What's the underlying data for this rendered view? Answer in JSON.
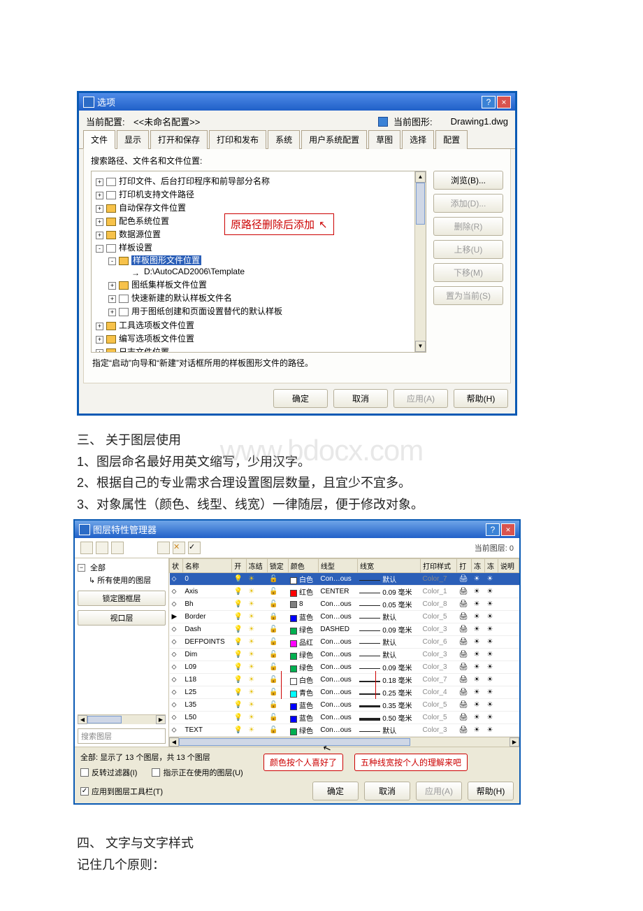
{
  "watermark": "www.bdocx.com",
  "dialog1": {
    "title": "选项",
    "profile_label": "当前配置:",
    "profile_value": "<<未命名配置>>",
    "drawing_label": "当前图形:",
    "drawing_value": "Drawing1.dwg",
    "tabs": [
      "文件",
      "显示",
      "打开和保存",
      "打印和发布",
      "系统",
      "用户系统配置",
      "草图",
      "选择",
      "配置"
    ],
    "active_tab": 0,
    "panel_label": "搜索路径、文件名和文件位置:",
    "tree": [
      {
        "exp": "+",
        "icon": "file",
        "label": "打印文件、后台打印程序和前导部分名称"
      },
      {
        "exp": "+",
        "icon": "file",
        "label": "打印机支持文件路径"
      },
      {
        "exp": "+",
        "icon": "folder",
        "label": "自动保存文件位置"
      },
      {
        "exp": "+",
        "icon": "folder",
        "label": "配色系统位置"
      },
      {
        "exp": "+",
        "icon": "folder",
        "label": "数据源位置"
      },
      {
        "exp": "-",
        "icon": "file",
        "label": "样板设置",
        "children": [
          {
            "exp": "-",
            "icon": "folder",
            "label": "样板图形文件位置",
            "selected": true,
            "children": [
              {
                "exp": "",
                "icon": "arrow",
                "label": "D:\\AutoCAD2006\\Template"
              }
            ]
          },
          {
            "exp": "+",
            "icon": "folder",
            "label": "图纸集样板文件位置"
          },
          {
            "exp": "+",
            "icon": "file",
            "label": "快速新建的默认样板文件名"
          },
          {
            "exp": "+",
            "icon": "file",
            "label": "用于图纸创建和页面设置替代的默认样板"
          }
        ]
      },
      {
        "exp": "+",
        "icon": "folder",
        "label": "工具选项板文件位置"
      },
      {
        "exp": "+",
        "icon": "folder",
        "label": "编写选项板文件位置"
      },
      {
        "exp": "+",
        "icon": "folder",
        "label": "日志文件位置"
      }
    ],
    "callout": "原路径删除后添加",
    "side_buttons": [
      {
        "label": "浏览(B)...",
        "enabled": true
      },
      {
        "label": "添加(D)...",
        "enabled": false
      },
      {
        "label": "删除(R)",
        "enabled": false
      },
      {
        "label": "上移(U)",
        "enabled": false
      },
      {
        "label": "下移(M)",
        "enabled": false
      },
      {
        "label": "置为当前(S)",
        "enabled": false
      }
    ],
    "hint": "指定“启动”向导和“新建”对话框所用的样板图形文件的路径。",
    "footer": [
      "确定",
      "取消",
      "应用(A)",
      "帮助(H)"
    ]
  },
  "section3": {
    "heading": "三、 关于图层使用",
    "lines": [
      "1、图层命名最好用英文缩写，少用汉字。",
      "2、根据自己的专业需求合理设置图层数量，且宜少不宜多。",
      "3、对象属性（颜色、线型、线宽）一律随层，便于修改对象。"
    ]
  },
  "dialog2": {
    "title": "图层特性管理器",
    "current_layer_label": "当前图层: 0",
    "filter_root": "全部",
    "filter_child": "所有使用的图层",
    "btn_lock": "锁定图框层",
    "btn_viewport": "视口层",
    "search_placeholder": "搜索图层",
    "columns": [
      "状",
      "名称",
      "开",
      "冻结",
      "锁定",
      "颜色",
      "线型",
      "线宽",
      "打印样式",
      "打",
      "冻",
      "冻",
      "说明"
    ],
    "rows": [
      {
        "name": "0",
        "on": true,
        "frz": false,
        "lock": false,
        "color": "#ffffff",
        "cname": "白色",
        "ltype": "Con…ous",
        "lw": "默认",
        "lwpx": 1,
        "plot": "Color_7",
        "sel": true
      },
      {
        "name": "Axis",
        "on": true,
        "frz": false,
        "lock": false,
        "color": "#ff0000",
        "cname": "红色",
        "ltype": "CENTER",
        "lw": "0.09 毫米",
        "lwpx": 1,
        "plot": "Color_1"
      },
      {
        "name": "Bh",
        "on": true,
        "frz": false,
        "lock": false,
        "color": "#808080",
        "cname": "8",
        "ltype": "Con…ous",
        "lw": "0.05 毫米",
        "lwpx": 1,
        "plot": "Color_8"
      },
      {
        "name": "Border",
        "on": true,
        "frz": false,
        "lock": true,
        "color": "#0000ff",
        "cname": "蓝色",
        "ltype": "Con…ous",
        "lw": "默认",
        "lwpx": 1,
        "plot": "Color_5",
        "cur": true
      },
      {
        "name": "Dash",
        "on": true,
        "frz": false,
        "lock": false,
        "color": "#00b050",
        "cname": "绿色",
        "ltype": "DASHED",
        "lw": "0.09 毫米",
        "lwpx": 1,
        "plot": "Color_3"
      },
      {
        "name": "DEFPOINTS",
        "on": true,
        "frz": false,
        "lock": false,
        "color": "#ff00ff",
        "cname": "品红",
        "ltype": "Con…ous",
        "lw": "默认",
        "lwpx": 1,
        "plot": "Color_6"
      },
      {
        "name": "Dim",
        "on": true,
        "frz": false,
        "lock": false,
        "color": "#00b050",
        "cname": "绿色",
        "ltype": "Con…ous",
        "lw": "默认",
        "lwpx": 1,
        "plot": "Color_3"
      },
      {
        "name": "L09",
        "on": true,
        "frz": false,
        "lock": false,
        "color": "#00b050",
        "cname": "绿色",
        "ltype": "Con…ous",
        "lw": "0.09 毫米",
        "lwpx": 1,
        "plot": "Color_3"
      },
      {
        "name": "L18",
        "on": true,
        "frz": false,
        "lock": false,
        "color": "#ffffff",
        "cname": "白色",
        "ltype": "Con…ous",
        "lw": "0.18 毫米",
        "lwpx": 2,
        "plot": "Color_7"
      },
      {
        "name": "L25",
        "on": true,
        "frz": false,
        "lock": false,
        "color": "#00ffff",
        "cname": "青色",
        "ltype": "Con…ous",
        "lw": "0.25 毫米",
        "lwpx": 2,
        "plot": "Color_4"
      },
      {
        "name": "L35",
        "on": true,
        "frz": false,
        "lock": false,
        "color": "#0000ff",
        "cname": "蓝色",
        "ltype": "Con…ous",
        "lw": "0.35 毫米",
        "lwpx": 3,
        "plot": "Color_5"
      },
      {
        "name": "L50",
        "on": true,
        "frz": false,
        "lock": false,
        "color": "#0000ff",
        "cname": "蓝色",
        "ltype": "Con…ous",
        "lw": "0.50 毫米",
        "lwpx": 4,
        "plot": "Color_5"
      },
      {
        "name": "TEXT",
        "on": true,
        "frz": false,
        "lock": false,
        "color": "#00b050",
        "cname": "绿色",
        "ltype": "Con…ous",
        "lw": "默认",
        "lwpx": 1,
        "plot": "Color_3"
      }
    ],
    "status": "全部: 显示了 13 个图层，共 13 个图层",
    "chk_invert": "反转过滤器(I)",
    "chk_inuse": "指示正在使用的图层(U)",
    "chk_apply": "应用到图层工具栏(T)",
    "footer": [
      "确定",
      "取消",
      "应用(A)",
      "帮助(H)"
    ],
    "bubble1": "颜色按个人喜好了",
    "bubble2": "五种线宽按个人的理解来吧"
  },
  "section4": {
    "heading": "四、 文字与文字样式",
    "line": "记住几个原则："
  }
}
